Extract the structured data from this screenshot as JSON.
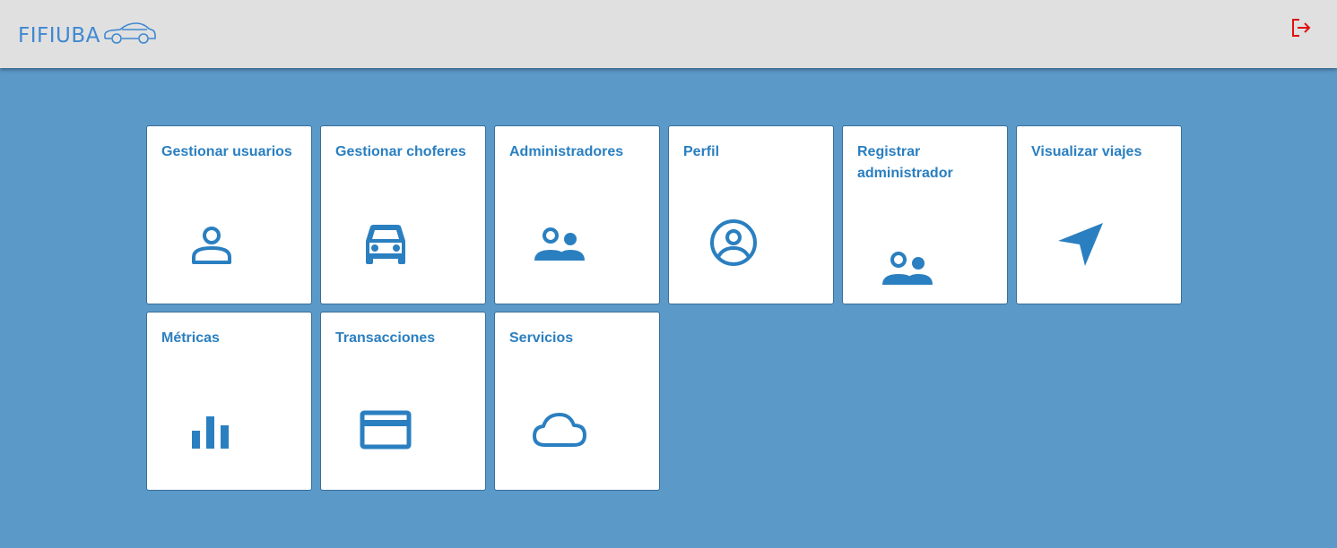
{
  "header": {
    "logo_text": "FIFIUBA",
    "logo_icon": "car-outline-icon",
    "logout_icon": "logout-icon",
    "logout_color": "#e01010"
  },
  "colors": {
    "background": "#5b99c8",
    "header": "#e0e0e0",
    "accent": "#2a7fc0",
    "logo": "#3f88d1"
  },
  "cards": [
    {
      "title": "Gestionar usuarios",
      "icon": "person-icon"
    },
    {
      "title": "Gestionar choferes",
      "icon": "car-icon"
    },
    {
      "title": "Administradores",
      "icon": "people-icon"
    },
    {
      "title": "Perfil",
      "icon": "account-circle-icon"
    },
    {
      "title": "Registrar administrador",
      "icon": "people-icon"
    },
    {
      "title": "Visualizar viajes",
      "icon": "navigation-icon"
    },
    {
      "title": "Métricas",
      "icon": "bar-chart-icon"
    },
    {
      "title": "Transacciones",
      "icon": "credit-card-icon"
    },
    {
      "title": "Servicios",
      "icon": "cloud-icon"
    }
  ]
}
